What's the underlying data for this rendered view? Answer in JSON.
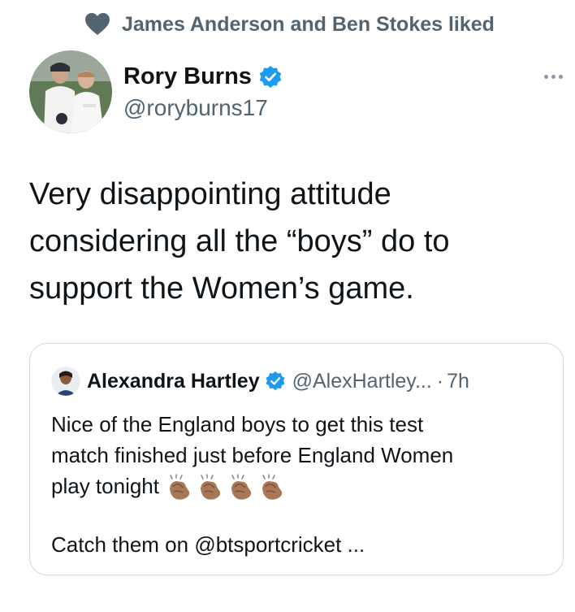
{
  "social_context": {
    "icon": "heart-icon",
    "text": "James Anderson and Ben Stokes liked"
  },
  "author": {
    "name": "Rory Burns",
    "handle": "@roryburns17",
    "verified": true,
    "avatar": "avatar"
  },
  "more": {
    "icon": "more-icon",
    "label": "···"
  },
  "tweet": {
    "lines": [
      "Very disappointing attitude",
      "considering all the “boys” do to",
      "support the Women’s game."
    ]
  },
  "quote": {
    "author_name": "Alexandra Hartley",
    "verified": true,
    "handle": "@AlexHartley...",
    "separator": "·",
    "time": "7h",
    "lines": [
      "Nice of the England boys to get this test",
      "match finished just before England Women",
      "play tonight"
    ],
    "emoji": [
      "clapping-hands-icon",
      "clapping-hands-icon",
      "clapping-hands-icon",
      "clapping-hands-icon"
    ],
    "footer": "Catch them on @btsportcricket ..."
  },
  "colors": {
    "text_primary": "#0f1419",
    "text_secondary": "#536471",
    "verified_blue": "#1d9bf0",
    "border": "#cfd9de"
  }
}
